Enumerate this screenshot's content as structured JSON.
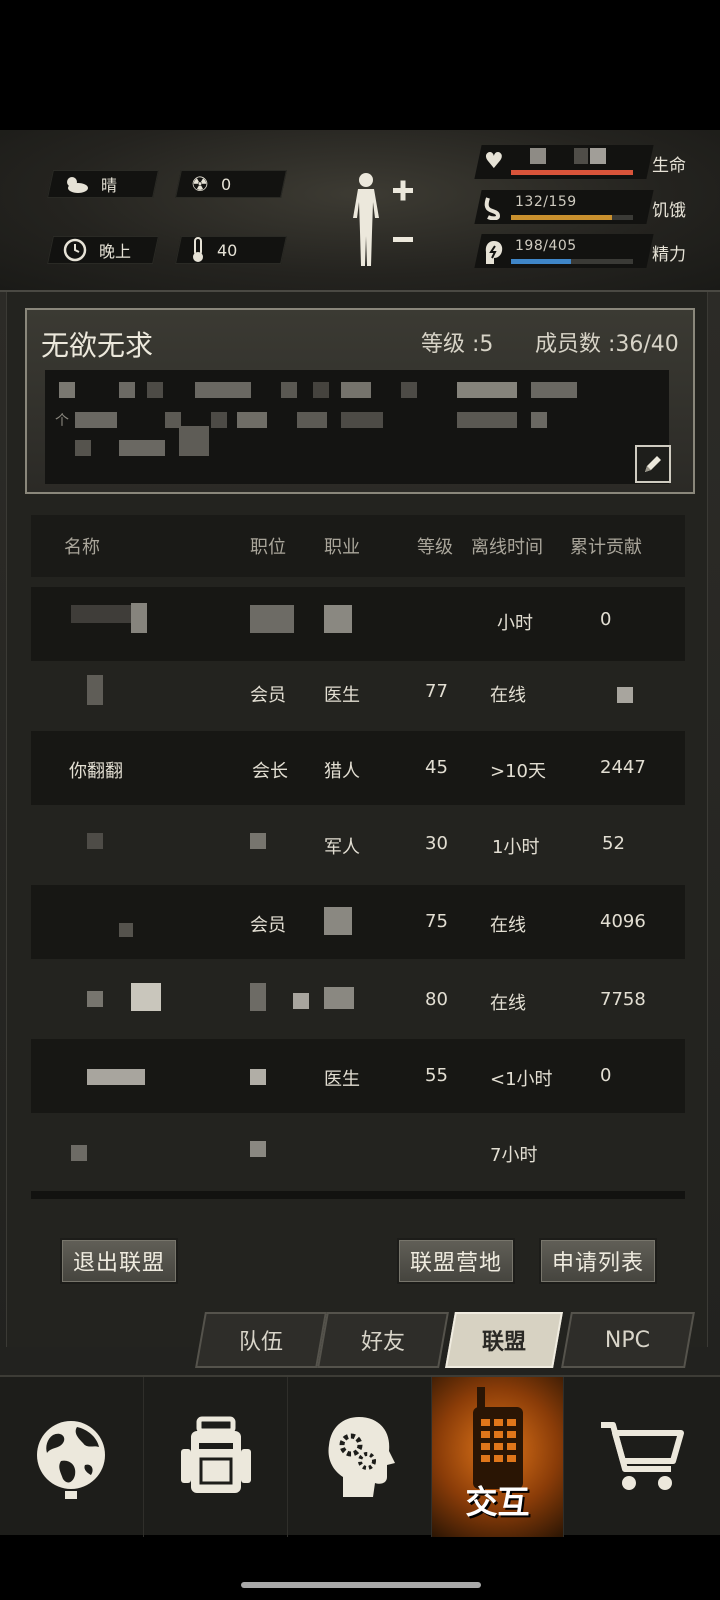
{
  "hud": {
    "weather": {
      "icon": "cloud-sun-icon",
      "label": "晴"
    },
    "radiation": {
      "icon": "radiation-icon",
      "value": "0"
    },
    "time": {
      "icon": "clock-icon",
      "label": "晚上"
    },
    "temperature": {
      "icon": "thermometer-icon",
      "value": "40"
    },
    "stats": [
      {
        "name": "life",
        "icon": "heart-icon",
        "value": "",
        "label": "生命",
        "fill_pct": 100,
        "color": "#d9543a"
      },
      {
        "name": "hunger",
        "icon": "stomach-icon",
        "value": "132/159",
        "label": "饥饿",
        "fill_pct": 83,
        "color": "#c9902e"
      },
      {
        "name": "energy",
        "icon": "brain-icon",
        "value": "198/405",
        "label": "精力",
        "fill_pct": 49,
        "color": "#3f86c8"
      }
    ]
  },
  "alliance": {
    "name": "无欲无求",
    "level": "等级 :5",
    "members": "成员数 :36/40",
    "desc_prefix": "个",
    "edit_icon": "pencil-icon"
  },
  "table": {
    "headers": [
      "名称",
      "职位",
      "职业",
      "等级",
      "离线时间",
      "累计贡献"
    ],
    "rows": [
      {
        "name": "",
        "position": "",
        "job": "",
        "level": "",
        "offline": "小时",
        "contribution": "0"
      },
      {
        "name": "",
        "position": "会员",
        "job": "医生",
        "level": "77",
        "offline": "在线",
        "contribution": ""
      },
      {
        "name": "你翻翻",
        "position": "会长",
        "job": "猎人",
        "level": "45",
        "offline": ">10天",
        "contribution": "2447"
      },
      {
        "name": "",
        "position": "",
        "job": "军人",
        "level": "30",
        "offline": "1小时",
        "contribution": "52"
      },
      {
        "name": "",
        "position": "会员",
        "job": "",
        "level": "75",
        "offline": "在线",
        "contribution": "4096"
      },
      {
        "name": "",
        "position": "",
        "job": "",
        "level": "80",
        "offline": "在线",
        "contribution": "7758"
      },
      {
        "name": "",
        "position": "",
        "job": "医生",
        "level": "55",
        "offline": "<1小时",
        "contribution": "0"
      },
      {
        "name": "",
        "position": "",
        "job": "",
        "level": "",
        "offline": "7小时",
        "contribution": ""
      }
    ]
  },
  "buttons": {
    "leave": "退出联盟",
    "camp": "联盟营地",
    "applications": "申请列表"
  },
  "tabs": [
    {
      "label": "队伍",
      "active": false
    },
    {
      "label": "好友",
      "active": false
    },
    {
      "label": "联盟",
      "active": true
    },
    {
      "label": "NPC",
      "active": false
    }
  ],
  "nav": [
    {
      "name": "map",
      "icon": "globe-icon",
      "label": ""
    },
    {
      "name": "inventory",
      "icon": "backpack-icon",
      "label": ""
    },
    {
      "name": "skills",
      "icon": "head-gears-icon",
      "label": ""
    },
    {
      "name": "interact",
      "icon": "walkie-talkie-icon",
      "label": "交互"
    },
    {
      "name": "shop",
      "icon": "shopping-cart-icon",
      "label": ""
    }
  ]
}
